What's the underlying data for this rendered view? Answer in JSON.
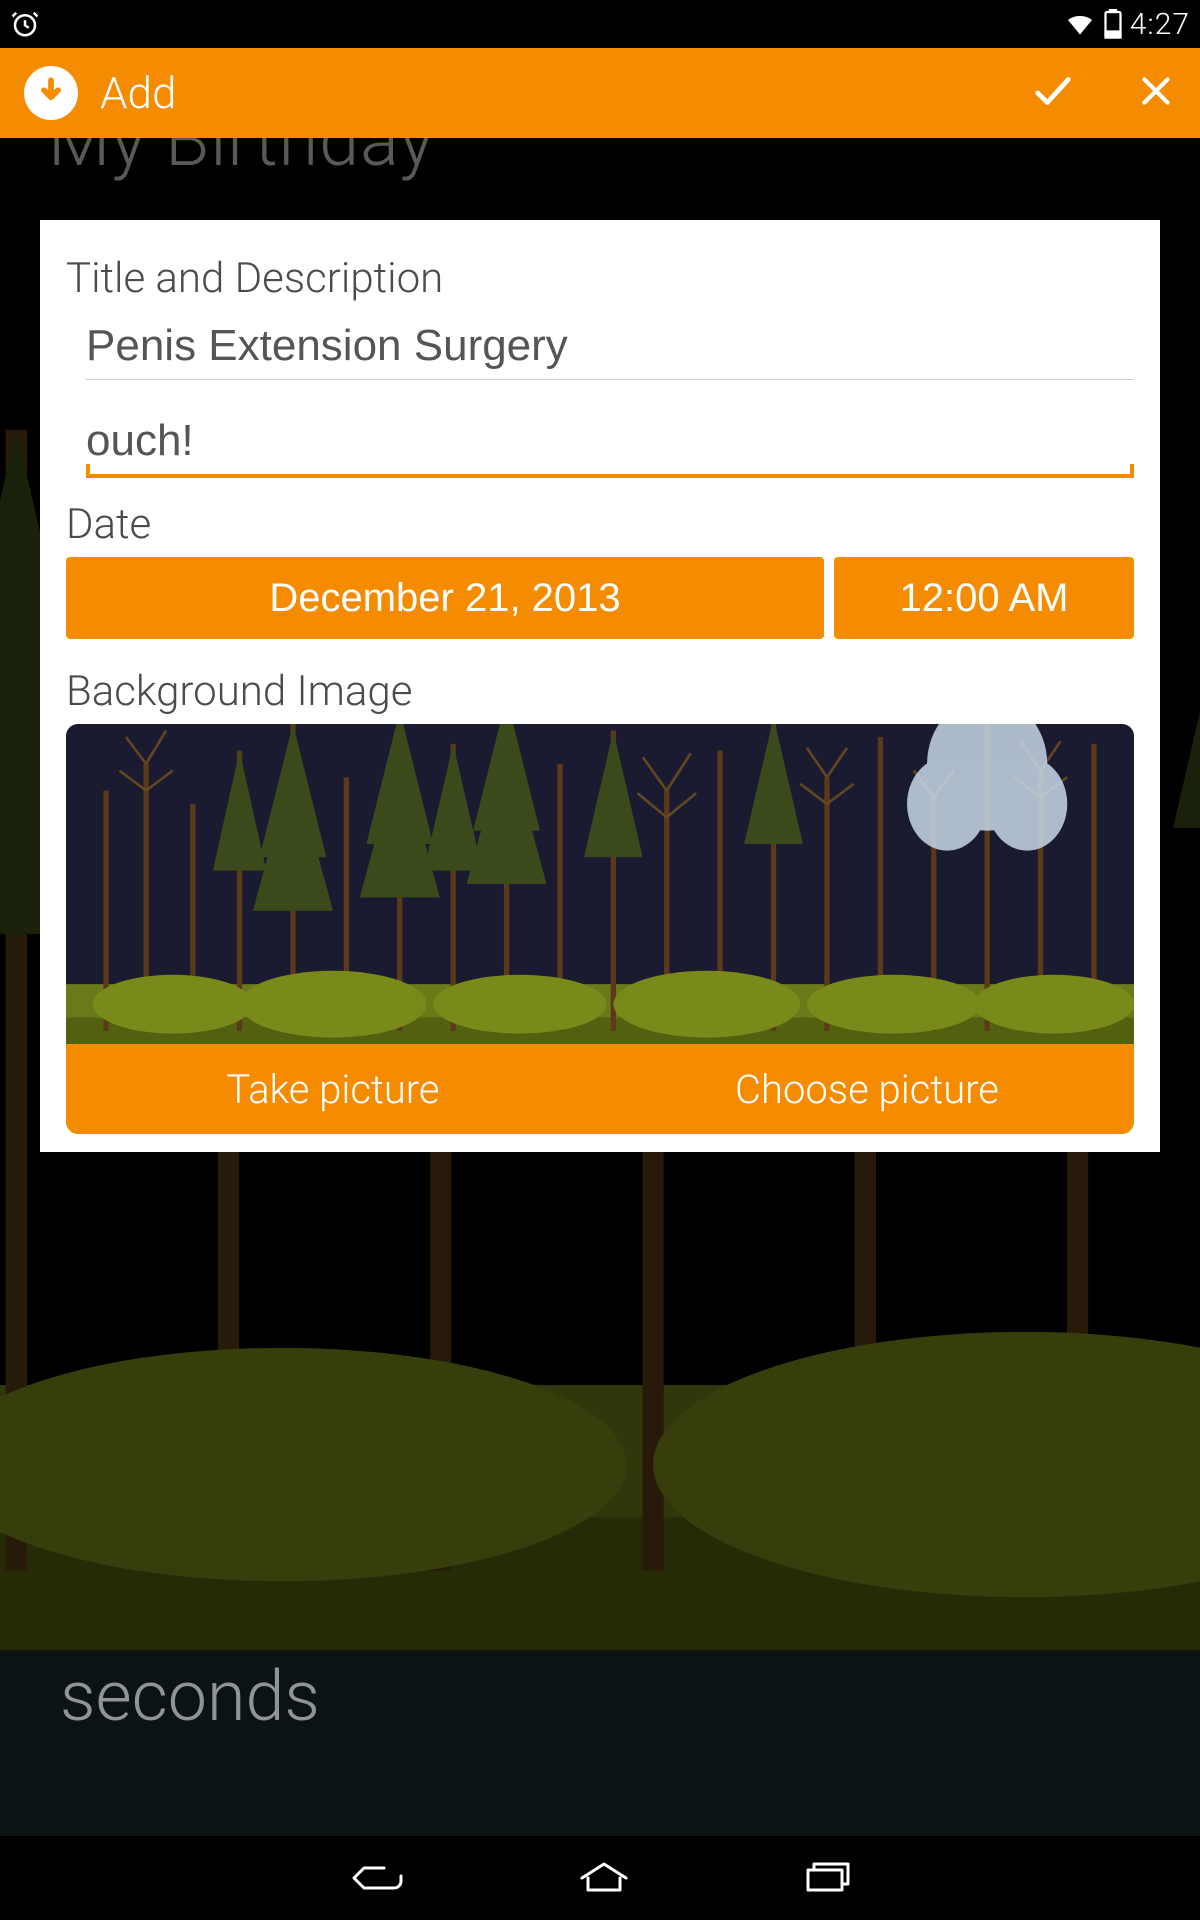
{
  "status": {
    "time": "4:27"
  },
  "app_bar": {
    "title": "Add"
  },
  "background_screen": {
    "title_peek": "My Birthday",
    "bottom_word": "seconds"
  },
  "dialog": {
    "title_section_label": "Title and Description",
    "title_value": "Penis Extension Surgery",
    "description_value": "ouch!",
    "date_section_label": "Date",
    "date_value": "December 21, 2013",
    "time_value": "12:00 AM",
    "bg_section_label": "Background Image",
    "take_picture_label": "Take picture",
    "choose_picture_label": "Choose picture"
  },
  "colors": {
    "accent": "#f58b00"
  }
}
